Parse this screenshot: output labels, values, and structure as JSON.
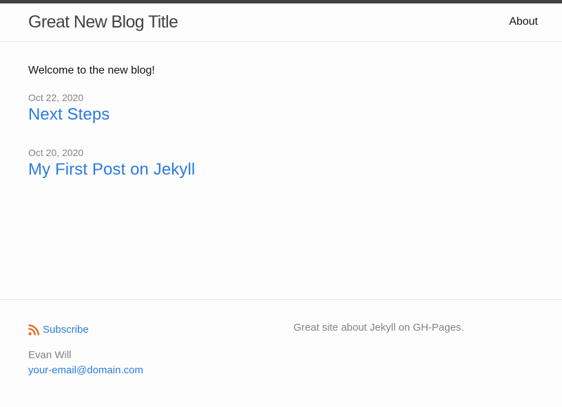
{
  "header": {
    "site_title": "Great New Blog Title",
    "nav": [
      {
        "label": "About"
      }
    ]
  },
  "main": {
    "welcome": "Welcome to the new blog!",
    "posts": [
      {
        "date": "Oct 22, 2020",
        "title": "Next Steps"
      },
      {
        "date": "Oct 20, 2020",
        "title": "My First Post on Jekyll"
      }
    ]
  },
  "footer": {
    "subscribe_label": "Subscribe",
    "subscribe_icon": "rss-icon",
    "author_name": "Evan Will",
    "author_email": "your-email@domain.com",
    "description": "Great site about Jekyll on GH-Pages."
  },
  "colors": {
    "link": "#2a7ae2",
    "meta": "#828282",
    "top_bar": "#424242",
    "rss": "#f26522"
  }
}
